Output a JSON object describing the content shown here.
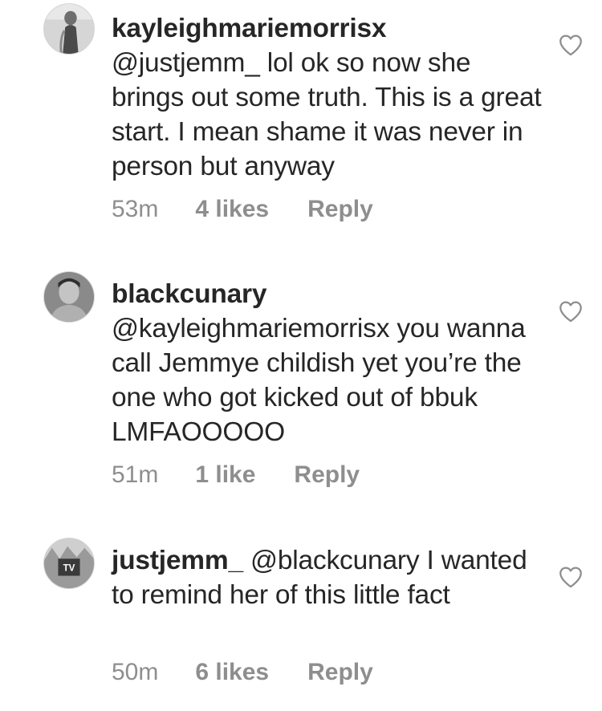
{
  "comments": [
    {
      "username": "kayleighmariemorrisx",
      "text": "@justjemm_ lol ok so now she brings out some truth. This is a great start. I mean shame it was never in person but  anyway",
      "time": "53m",
      "likes": "4 likes",
      "reply": "Reply",
      "avatar_icon": "avatar-photo",
      "like_icon": "heart-outline-icon"
    },
    {
      "username": "blackcunary",
      "text": "@kayleighmariemorrisx you wanna call Jemmye childish yet you’re the one who got kicked out of bbuk LMFAOOOOO",
      "time": "51m",
      "likes": "1 like",
      "reply": "Reply",
      "avatar_icon": "avatar-photo",
      "like_icon": "heart-outline-icon"
    },
    {
      "username": "justjemm_",
      "text": "@blackcunary I wanted to remind her of this little fact",
      "time": "50m",
      "likes": "6 likes",
      "reply": "Reply",
      "avatar_icon": "avatar-photo",
      "like_icon": "heart-outline-icon"
    }
  ]
}
